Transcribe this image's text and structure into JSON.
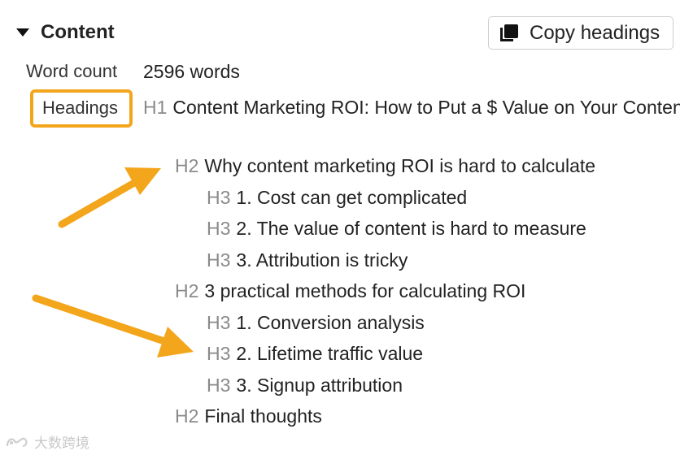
{
  "section": {
    "title": "Content"
  },
  "copy_button": {
    "label": "Copy headings",
    "icon": "copy-icon"
  },
  "word_count": {
    "label": "Word count",
    "value": "2596 words"
  },
  "headings": {
    "label": "Headings",
    "items": [
      {
        "level": "H1",
        "text": "Content Marketing ROI: How to Put a $ Value on Your Content"
      },
      {
        "level": "H2",
        "text": "Why content marketing ROI is hard to calculate"
      },
      {
        "level": "H3",
        "text": "1. Cost can get complicated"
      },
      {
        "level": "H3",
        "text": "2. The value of content is hard to measure"
      },
      {
        "level": "H3",
        "text": "3. Attribution is tricky"
      },
      {
        "level": "H2",
        "text": "3 practical methods for calculating ROI"
      },
      {
        "level": "H3",
        "text": "1. Conversion analysis"
      },
      {
        "level": "H3",
        "text": "2. Lifetime traffic value"
      },
      {
        "level": "H3",
        "text": "3. Signup attribution"
      },
      {
        "level": "H2",
        "text": "Final thoughts"
      }
    ]
  },
  "annotation": {
    "highlight_color": "#f3a61c",
    "arrows": [
      "arrow-icon",
      "arrow-icon"
    ]
  },
  "watermark": {
    "text": "大数跨境"
  }
}
